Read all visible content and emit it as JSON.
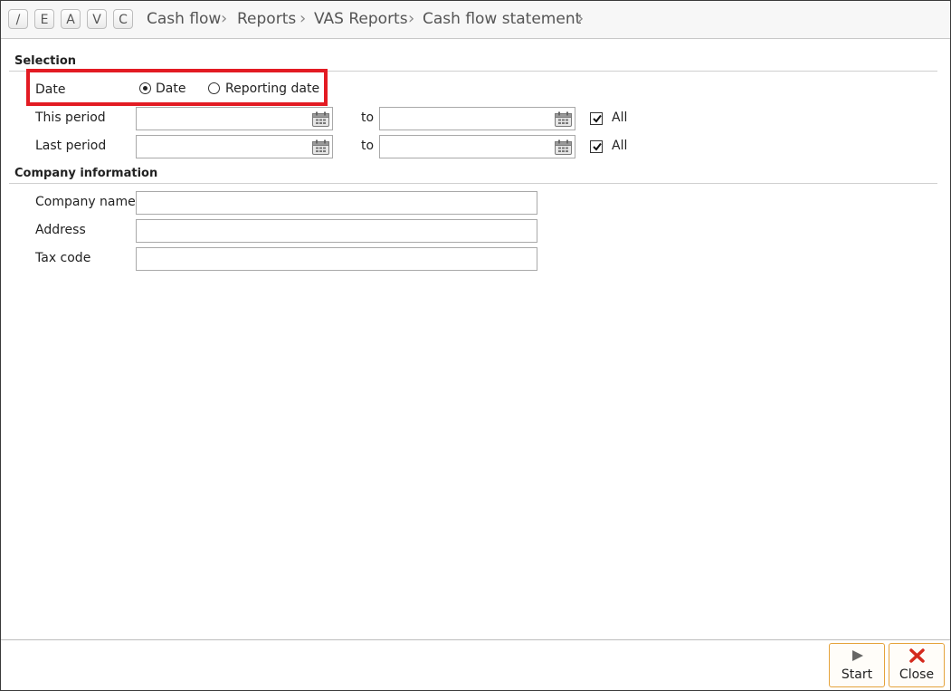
{
  "toolbar": {
    "mode_buttons": [
      "/",
      "E",
      "A",
      "V",
      "C"
    ]
  },
  "breadcrumb": [
    "Cash flow",
    "Reports",
    "VAS Reports",
    "Cash flow statement"
  ],
  "selection": {
    "title": "Selection",
    "date_label": "Date",
    "date_options": [
      {
        "label": "Date",
        "selected": true
      },
      {
        "label": "Reporting date",
        "selected": false
      }
    ],
    "this_period_label": "This period",
    "last_period_label": "Last period",
    "to_label": "to",
    "all_label": "All",
    "this_period_all_checked": true,
    "last_period_all_checked": true
  },
  "company": {
    "title": "Company information",
    "name_label": "Company name",
    "address_label": "Address",
    "tax_code_label": "Tax code"
  },
  "actions": {
    "start_label": "Start",
    "close_label": "Close"
  },
  "colors": {
    "highlight": "#e31b23",
    "button_border": "#e5a33c",
    "close_icon": "#d42a1e"
  }
}
